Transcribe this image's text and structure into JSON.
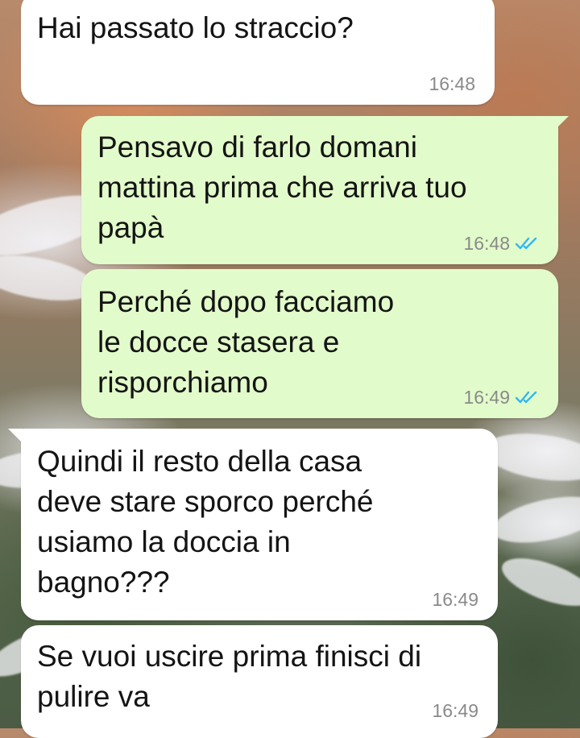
{
  "messages": [
    {
      "direction": "in",
      "text": "Hai passato lo straccio?",
      "time": "16:48"
    },
    {
      "direction": "out",
      "text": "Pensavo di farlo domani\nmattina prima che arriva tuo\npapà",
      "time": "16:48",
      "status": "read",
      "status_icon": "double-check-icon",
      "status_color": "#34b7f1"
    },
    {
      "direction": "out",
      "text": "Perché dopo facciamo\nle docce stasera e\nrisporchiamo",
      "time": "16:49",
      "status": "read",
      "status_icon": "double-check-icon",
      "status_color": "#34b7f1"
    },
    {
      "direction": "in",
      "text": "Quindi il resto della casa\ndeve stare sporco perché\nusiamo la doccia in\nbagno???",
      "time": "16:49"
    },
    {
      "direction": "in",
      "text": "Se vuoi uscire prima finisci di\npulire va",
      "time": "16:49"
    }
  ],
  "colors": {
    "incoming_bubble": "#ffffff",
    "outgoing_bubble": "#e2fbca",
    "text": "#141414",
    "timestamp": "#8a8a8a",
    "read_ticks": "#34b7f1"
  }
}
